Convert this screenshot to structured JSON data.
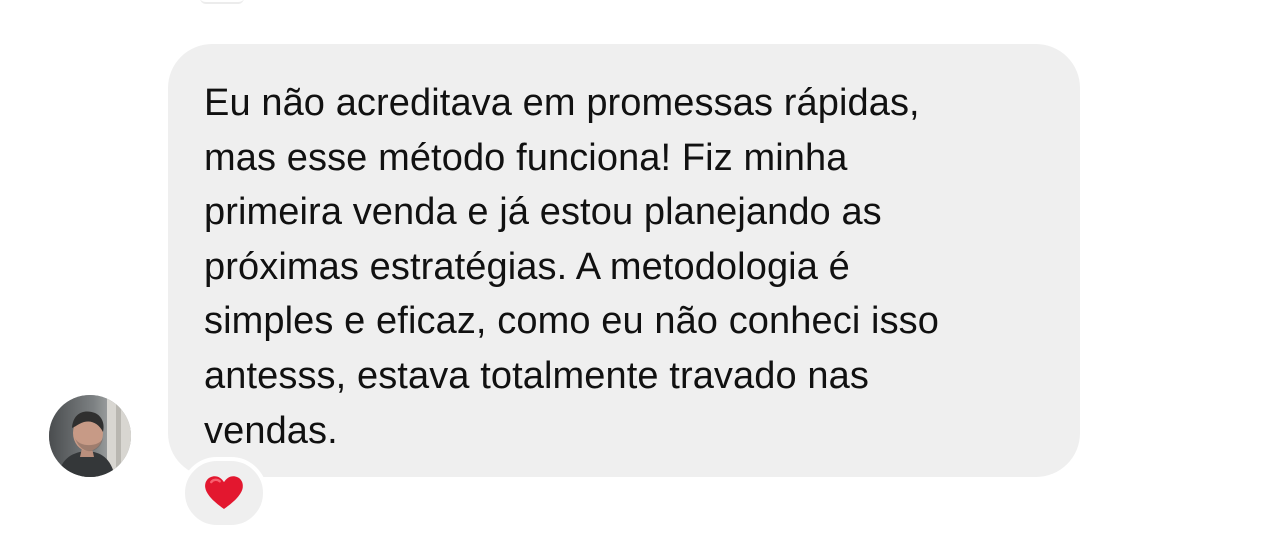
{
  "message": {
    "text": "Eu não acreditava em promessas rápidas,\nmas esse método funciona! Fiz minha\nprimeira venda e já estou planejando as\npróximas estratégias. A metodologia é\nsimples e eficaz, como eu não conheci isso\nantesss, estava totalmente travado nas\nvendas.",
    "reaction_icon": "red-heart-icon",
    "avatar_icon": "user-avatar-photo"
  },
  "colors": {
    "bubble_background": "#efefef",
    "text": "#111111",
    "heart": "#e3172f"
  }
}
